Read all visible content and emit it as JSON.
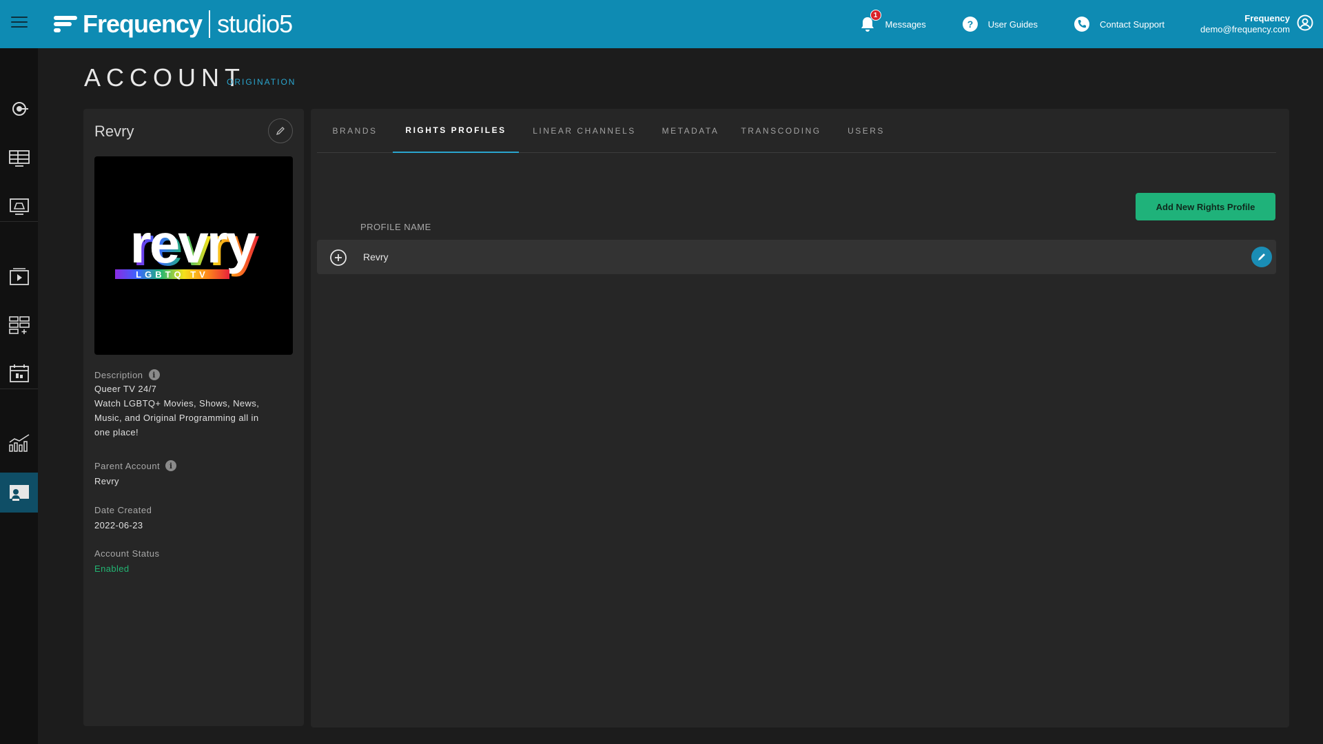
{
  "header": {
    "brand": "Frequency",
    "product": "studio5",
    "messages": {
      "label": "Messages",
      "count": "1"
    },
    "user_guides": "User Guides",
    "contact_support": "Contact Support",
    "user": {
      "name": "Frequency",
      "email": "demo@frequency.com"
    }
  },
  "sidebar": {
    "items": [
      {
        "icon": "origination-icon"
      },
      {
        "icon": "grid-layout-icon"
      },
      {
        "icon": "monitor-icon"
      },
      {
        "icon": "media-player-icon"
      },
      {
        "icon": "playlist-add-icon"
      },
      {
        "icon": "calendar-schedule-icon"
      },
      {
        "icon": "analytics-chart-icon"
      },
      {
        "icon": "account-card-icon",
        "active": true
      }
    ]
  },
  "page": {
    "title": "ACCOUNT",
    "subtitle": "ORIGINATION"
  },
  "account": {
    "name": "Revry",
    "logo_text": "revry",
    "logo_subtext": "LGBTQ TV",
    "description_label": "Description",
    "description_lines": [
      "Queer TV 24/7",
      "Watch LGBTQ+ Movies, Shows, News,",
      "Music, and Original Programming all in",
      "one place!"
    ],
    "parent_account_label": "Parent Account",
    "parent_account": "Revry",
    "date_created_label": "Date Created",
    "date_created": "2022-06-23",
    "account_status_label": "Account Status",
    "account_status": "Enabled"
  },
  "tabs": [
    {
      "label": "BRANDS"
    },
    {
      "label": "RIGHTS PROFILES",
      "active": true
    },
    {
      "label": "LINEAR CHANNELS"
    },
    {
      "label": "METADATA"
    },
    {
      "label": "TRANSCODING"
    },
    {
      "label": "USERS"
    }
  ],
  "rights_profiles": {
    "add_button": "Add New Rights Profile",
    "column_header": "PROFILE NAME",
    "rows": [
      {
        "name": "Revry"
      }
    ]
  },
  "colors": {
    "topbar": "#0e8bb3",
    "accent": "#2aa6cf",
    "success": "#1fb27a",
    "status_enabled": "#22b573",
    "badge": "#d8232a"
  }
}
